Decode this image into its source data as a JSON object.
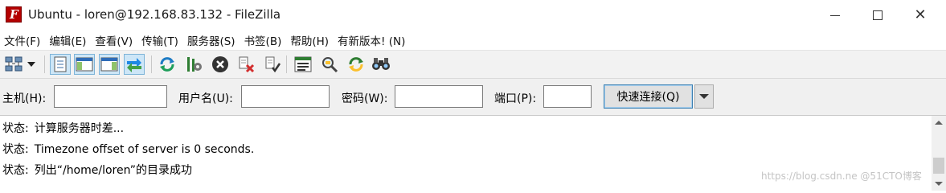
{
  "window": {
    "title": "Ubuntu - loren@192.168.83.132 - FileZilla",
    "app_icon": "filezilla-icon"
  },
  "menu": [
    "文件(F)",
    "编辑(E)",
    "查看(V)",
    "传输(T)",
    "服务器(S)",
    "书签(B)",
    "帮助(H)",
    "有新版本! (N)"
  ],
  "toolbar": {
    "icons": [
      "site-manager-icon",
      "dropdown-arrow-icon",
      "toggle-message-log-icon",
      "toggle-local-tree-icon",
      "toggle-remote-tree-icon",
      "toggle-transfer-queue-icon",
      "refresh-icon",
      "process-queue-icon",
      "cancel-icon",
      "disconnect-icon",
      "reconnect-icon",
      "directory-listing-filters-icon",
      "compare-directories-icon",
      "sync-browsing-icon",
      "find-files-icon"
    ]
  },
  "quickconnect": {
    "host_label": "主机(H):",
    "host_value": "",
    "user_label": "用户名(U):",
    "user_value": "",
    "pass_label": "密码(W):",
    "pass_value": "",
    "port_label": "端口(P):",
    "port_value": "",
    "connect_button": "快速连接(Q)"
  },
  "log": {
    "lines": [
      {
        "status": "状态:",
        "message": "计算服务器时差..."
      },
      {
        "status": "状态:",
        "message": "Timezone offset of server is 0 seconds."
      },
      {
        "status": "状态:",
        "message": "列出“/home/loren”的目录成功"
      }
    ]
  },
  "watermark": "https://blog.csdn.ne @51CTO博客",
  "colors": {
    "toolbar_bg": "#f2f2f2",
    "quickconnect_bg": "#f0f0f0",
    "button_border": "#3c7fb1",
    "active_toggle": "#cde6f7"
  }
}
